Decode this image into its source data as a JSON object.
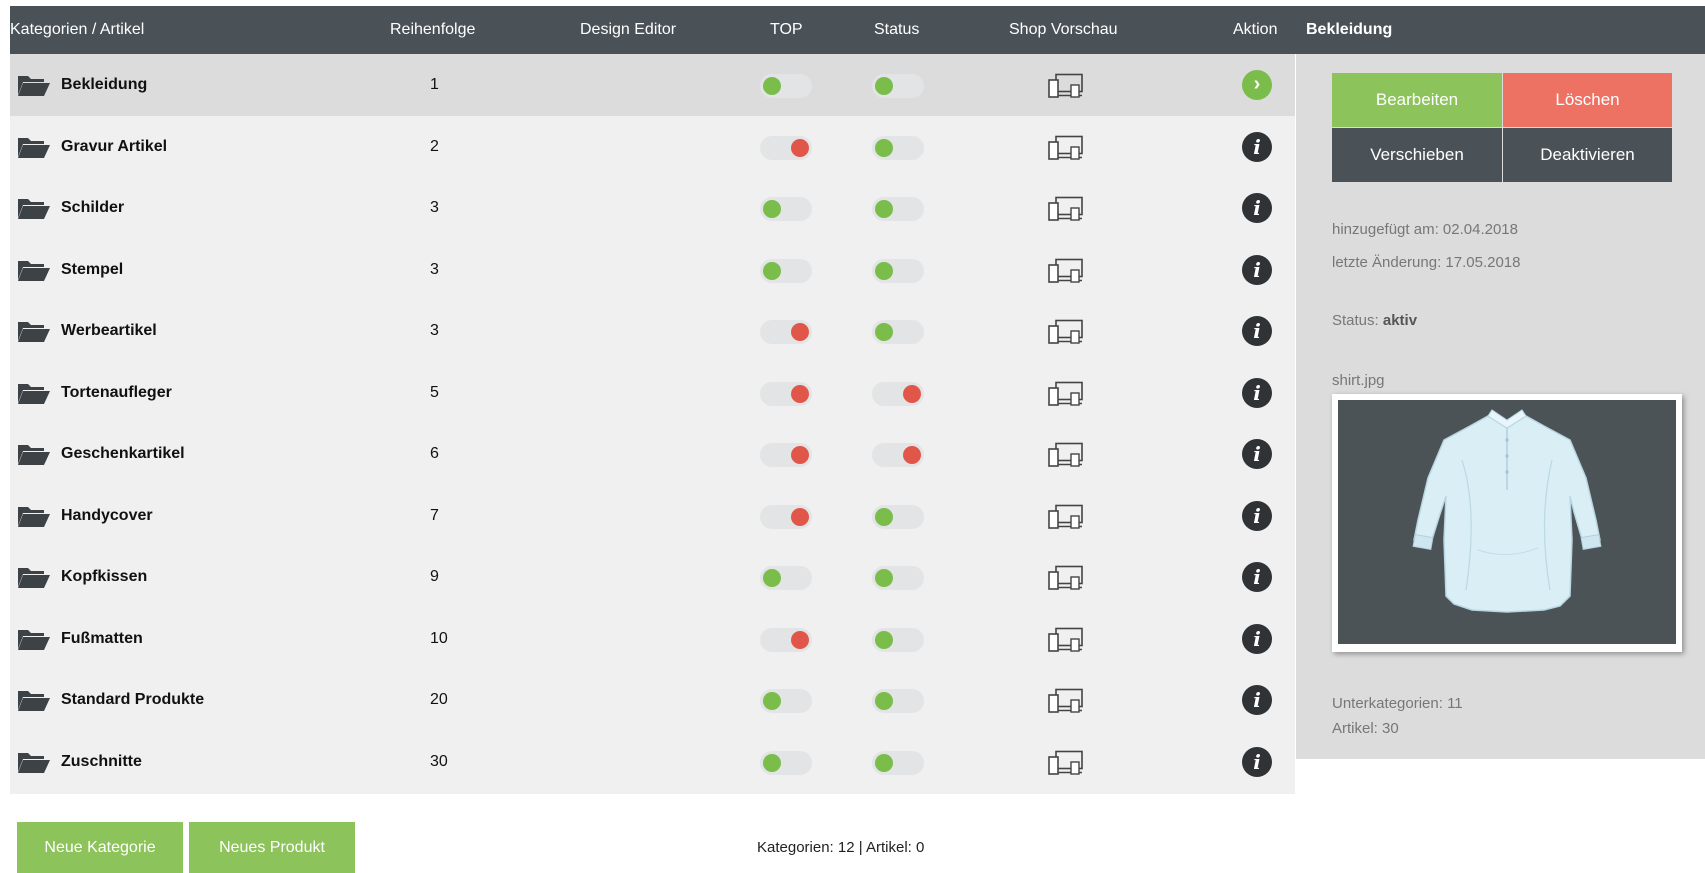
{
  "header": {
    "col_category": "Kategorien / Artikel",
    "col_order": "Reihenfolge",
    "col_design": "Design Editor",
    "col_top": "TOP",
    "col_status": "Status",
    "col_preview": "Shop Vorschau",
    "col_action": "Aktion",
    "panel_title": "Bekleidung"
  },
  "rows": [
    {
      "name": "Bekleidung",
      "order": "1",
      "top": "on",
      "status": "on",
      "action": "arrow",
      "selected": true
    },
    {
      "name": "Gravur Artikel",
      "order": "2",
      "top": "off",
      "status": "on",
      "action": "info"
    },
    {
      "name": "Schilder",
      "order": "3",
      "top": "on",
      "status": "on",
      "action": "info"
    },
    {
      "name": "Stempel",
      "order": "3",
      "top": "on",
      "status": "on",
      "action": "info"
    },
    {
      "name": "Werbeartikel",
      "order": "3",
      "top": "off",
      "status": "on",
      "action": "info"
    },
    {
      "name": "Tortenaufleger",
      "order": "5",
      "top": "off",
      "status": "off",
      "action": "info"
    },
    {
      "name": "Geschenkartikel",
      "order": "6",
      "top": "off",
      "status": "off",
      "action": "info"
    },
    {
      "name": "Handycover",
      "order": "7",
      "top": "off",
      "status": "on",
      "action": "info"
    },
    {
      "name": "Kopfkissen",
      "order": "9",
      "top": "on",
      "status": "on",
      "action": "info"
    },
    {
      "name": "Fußmatten",
      "order": "10",
      "top": "off",
      "status": "on",
      "action": "info"
    },
    {
      "name": "Standard Produkte",
      "order": "20",
      "top": "on",
      "status": "on",
      "action": "info"
    },
    {
      "name": "Zuschnitte",
      "order": "30",
      "top": "on",
      "status": "on",
      "action": "info"
    }
  ],
  "icons": {
    "folder": "folder-icon",
    "preview": "devices-icon",
    "info": "info-icon",
    "arrow": "chevron-right-icon"
  },
  "panel": {
    "edit_label": "Bearbeiten",
    "delete_label": "Löschen",
    "move_label": "Verschieben",
    "deactivate_label": "Deaktivieren",
    "added": "hinzugefügt am: 02.04.2018",
    "changed": "letzte Änderung: 17.05.2018",
    "status_label": "Status:",
    "status_value": "aktiv",
    "image_file": "shirt.jpg",
    "subcategories": "Unterkategorien: 11",
    "articles": "Artikel: 30"
  },
  "footer": {
    "new_category_label": "Neue Kategorie",
    "new_product_label": "Neues Produkt",
    "summary": "Kategorien: 12 | Artikel: 0"
  },
  "colors": {
    "header_bg": "#4a5157",
    "green": "#8cc35a",
    "red": "#ee7263",
    "toggle_on": "#7bbd4a",
    "toggle_off": "#e0574a"
  }
}
